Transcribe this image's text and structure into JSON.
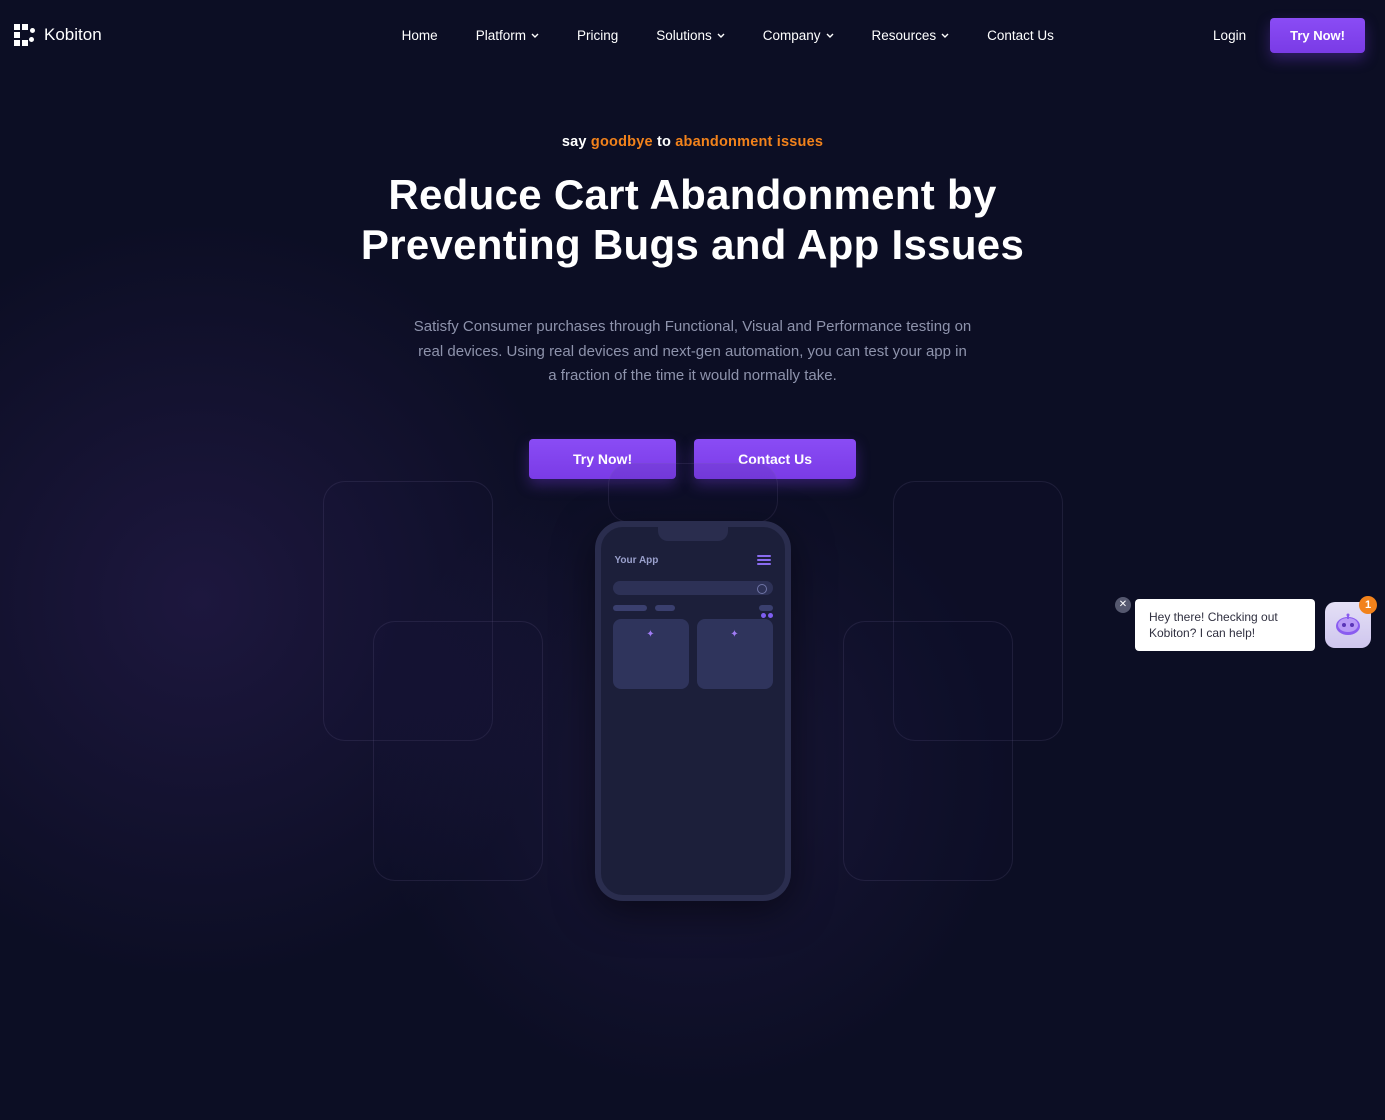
{
  "brand": "Kobiton",
  "nav": {
    "items": [
      {
        "label": "Home",
        "dropdown": false
      },
      {
        "label": "Platform",
        "dropdown": true
      },
      {
        "label": "Pricing",
        "dropdown": false
      },
      {
        "label": "Solutions",
        "dropdown": true
      },
      {
        "label": "Company",
        "dropdown": true
      },
      {
        "label": "Resources",
        "dropdown": true
      },
      {
        "label": "Contact Us",
        "dropdown": false
      }
    ],
    "login": "Login",
    "try_now": "Try Now!"
  },
  "hero": {
    "eyebrow_pre": "say ",
    "eyebrow_goodbye": "goodbye",
    "eyebrow_mid": " to ",
    "eyebrow_topic": "abandonment issues",
    "title_line1": "Reduce Cart Abandonment by",
    "title_line2": "Preventing Bugs and App Issues",
    "subtext": "Satisfy Consumer purchases through Functional, Visual and Performance testing on real devices. Using real devices and next-gen automation, you can test your app in a fraction of the time it would normally take.",
    "cta_try": "Try Now!",
    "cta_contact": "Contact Us"
  },
  "phone": {
    "app_title": "Your App"
  },
  "chat": {
    "message": "Hey there! Checking out Kobiton? I can help!",
    "badge": "1"
  },
  "colors": {
    "accent": "#7a3be6",
    "orange": "#f2821b"
  }
}
